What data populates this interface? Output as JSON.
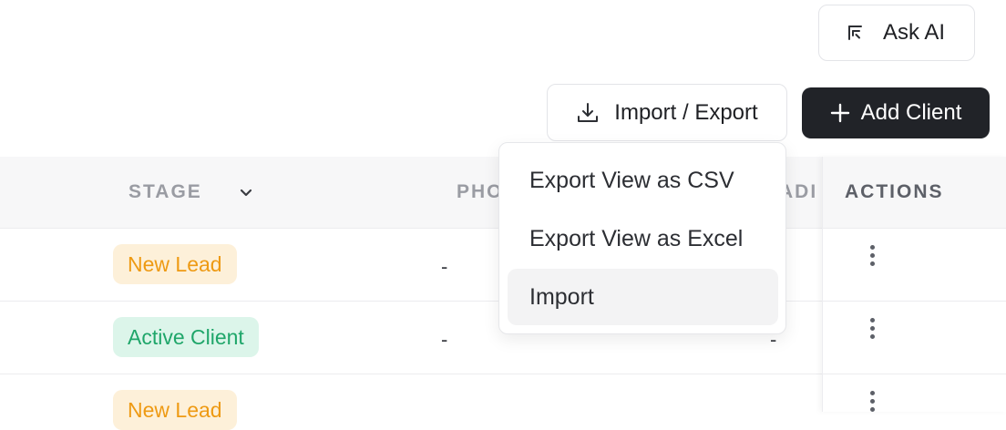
{
  "toolbar": {
    "ask_ai_label": "Ask AI",
    "import_export_label": "Import / Export",
    "add_client_label": "Add Client"
  },
  "table": {
    "columns": [
      "STAGE",
      "PHO",
      "ADI",
      "ACTIONS"
    ],
    "rows": [
      {
        "stage": "New Lead",
        "phone": "-",
        "address": ""
      },
      {
        "stage": "Active Client",
        "phone": "-",
        "address": "-"
      },
      {
        "stage": "New Lead",
        "phone": "",
        "address": ""
      }
    ]
  },
  "dropdown": {
    "items": [
      "Export View as CSV",
      "Export View as Excel",
      "Import"
    ],
    "highlighted_index": 2
  },
  "colors": {
    "primary_button": "#212328",
    "new_lead_bg": "#fdf0d9",
    "new_lead_text": "#ee9a13",
    "active_client_bg": "#dcf5ea",
    "active_client_text": "#1fa66a"
  },
  "icons": {
    "ask_ai": "ai-sparkle-icon",
    "import_export": "download-icon",
    "add_client": "plus-icon",
    "sort": "chevron-down-icon",
    "row_actions": "kebab-icon"
  }
}
